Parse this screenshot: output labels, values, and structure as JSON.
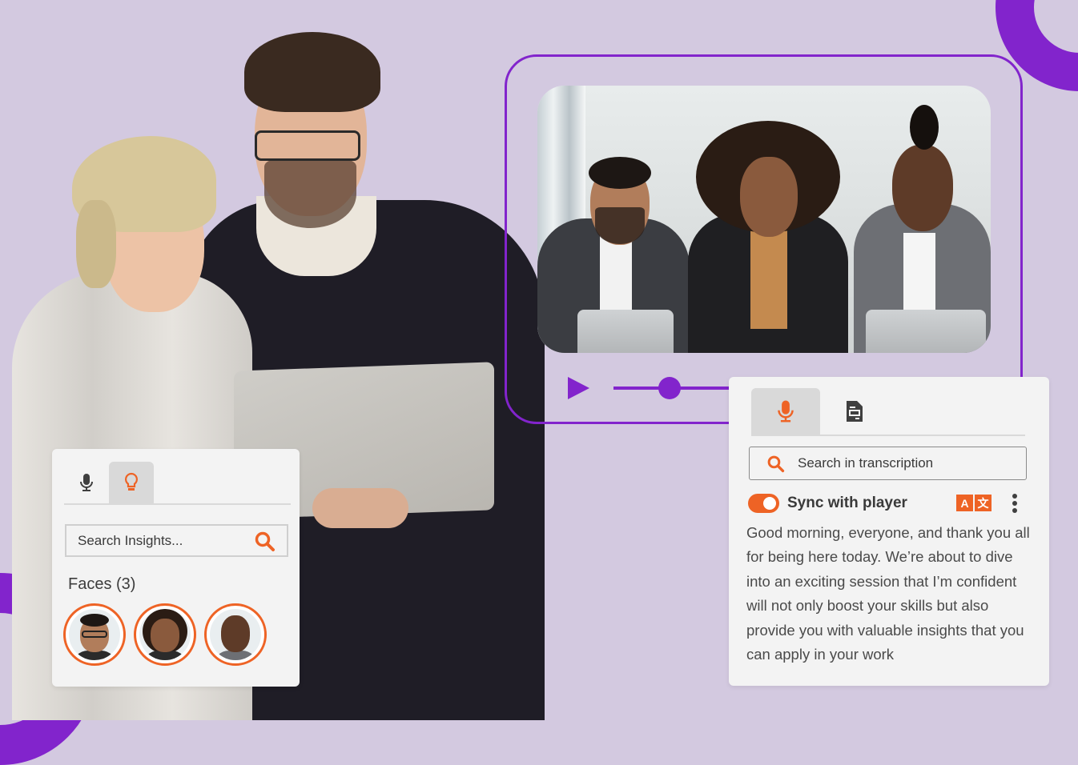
{
  "colors": {
    "background": "#d3c9e0",
    "accent_purple": "#8224cc",
    "accent_orange": "#ee6325",
    "panel_bg": "#f3f3f3",
    "text_dark": "#3a3a3a"
  },
  "player": {
    "play_icon": "play-icon",
    "progress": 0.35
  },
  "insights_panel": {
    "tabs": [
      {
        "icon": "microphone-icon",
        "active": false
      },
      {
        "icon": "lightbulb-icon",
        "active": true
      }
    ],
    "search_placeholder": "Search Insights...",
    "search_icon": "search-icon",
    "faces_title": "Faces (3)",
    "faces": [
      {
        "label": "face-1"
      },
      {
        "label": "face-2"
      },
      {
        "label": "face-3"
      }
    ]
  },
  "transcript_panel": {
    "tabs": [
      {
        "icon": "microphone-icon",
        "active": true
      },
      {
        "icon": "document-icon",
        "active": false
      }
    ],
    "search_placeholder": "Search in transcription",
    "search_icon": "search-icon",
    "sync_label": "Sync with player",
    "sync_enabled": true,
    "translate_icon": {
      "left": "A",
      "right": "文"
    },
    "more_icon": "kebab-menu-icon",
    "text": "Good morning, everyone, and thank you all for being here today. We’re about to dive into an exciting session that I’m confident will not only boost your skills but also provide you with valuable insights that you can apply in your work"
  }
}
